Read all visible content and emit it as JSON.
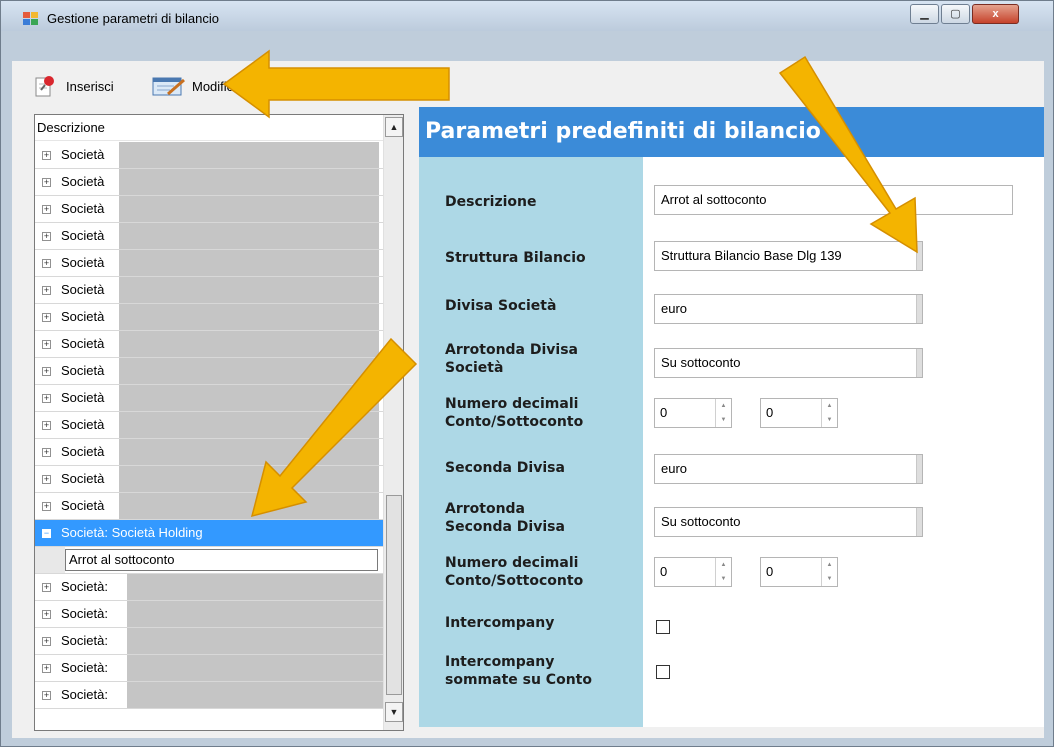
{
  "window": {
    "title": "Gestione parametri di bilancio",
    "min_symbol": "▁",
    "max_symbol": "▢",
    "close_symbol": "x"
  },
  "toolbar": {
    "insert_label": "Inserisci",
    "modify_label": "Modifica"
  },
  "tree": {
    "header": "Descrizione",
    "items_before": [
      {
        "expander": "+",
        "label": "Società"
      },
      {
        "expander": "+",
        "label": "Società"
      },
      {
        "expander": "+",
        "label": "Società"
      },
      {
        "expander": "+",
        "label": "Società"
      },
      {
        "expander": "+",
        "label": "Società"
      },
      {
        "expander": "+",
        "label": "Società"
      },
      {
        "expander": "+",
        "label": "Società"
      },
      {
        "expander": "+",
        "label": "Società"
      },
      {
        "expander": "+",
        "label": "Società"
      },
      {
        "expander": "+",
        "label": "Società"
      },
      {
        "expander": "+",
        "label": "Società"
      },
      {
        "expander": "+",
        "label": "Società"
      },
      {
        "expander": "+",
        "label": "Società"
      },
      {
        "expander": "+",
        "label": "Società"
      }
    ],
    "selected": {
      "expander": "−",
      "label": "Società: Società Holding"
    },
    "child": {
      "label": "Arrot al sottoconto"
    },
    "items_after": [
      {
        "expander": "+",
        "label": "Società:"
      },
      {
        "expander": "+",
        "label": "Società:"
      },
      {
        "expander": "+",
        "label": "Società:"
      },
      {
        "expander": "+",
        "label": "Società:"
      },
      {
        "expander": "+",
        "label": "Società:"
      }
    ],
    "scroll_up": "▲",
    "scroll_down": "▼"
  },
  "panel": {
    "title": "Parametri predefiniti di bilancio",
    "fields": {
      "descrizione": {
        "label": "Descrizione",
        "value": "Arrot al sottoconto"
      },
      "struttura": {
        "label": "Struttura Bilancio",
        "value": "Struttura Bilancio Base Dlg 139"
      },
      "divisa": {
        "label": "Divisa Società",
        "value": "euro"
      },
      "arrotonda_divisa": {
        "label_line1": "Arrotonda Divisa",
        "label_line2": "Società",
        "value": "Su sottoconto"
      },
      "decimali1": {
        "label_line1": "Numero decimali",
        "label_line2": "Conto/Sottoconto",
        "conto": "0",
        "sottoconto": "0"
      },
      "seconda_divisa": {
        "label": "Seconda Divisa",
        "value": "euro"
      },
      "arrotonda_seconda": {
        "label_line1": "Arrotonda",
        "label_line2": "Seconda Divisa",
        "value": "Su sottoconto"
      },
      "decimali2": {
        "label_line1": "Numero decimali",
        "label_line2": "Conto/Sottoconto",
        "conto": "0",
        "sottoconto": "0"
      },
      "intercompany": {
        "label": "Intercompany",
        "checked": false
      },
      "intercompany_conto": {
        "label_line1": "Intercompany",
        "label_line2": "sommate su Conto",
        "checked": false
      }
    },
    "spin_up": "▲",
    "spin_down": "▼"
  },
  "colors": {
    "accent": "#3399ff",
    "header_blue": "#3b8bd8",
    "label_column": "#add8e6",
    "annotation_arrow": "#f4b400"
  }
}
